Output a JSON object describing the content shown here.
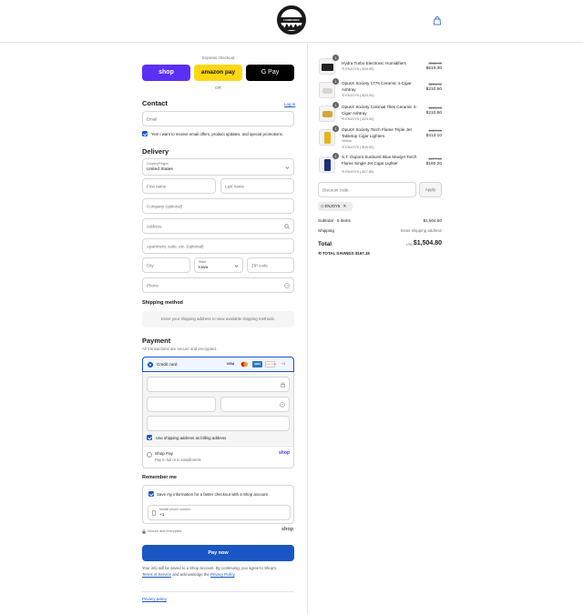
{
  "header": {
    "logo_text": "HUMIDORS",
    "cart_icon": "shopping-bag-icon"
  },
  "express": {
    "label": "Express checkout",
    "shop": "shop",
    "amazon": "amazon pay",
    "gpay": "G Pay",
    "or": "OR"
  },
  "contact": {
    "title": "Contact",
    "login": "Log in",
    "email_placeholder": "Email",
    "newsletter": "Yes! I want to receive email offers, product updates, and special promotions."
  },
  "delivery": {
    "title": "Delivery",
    "country_label": "Country/Region",
    "country_value": "United States",
    "first_name": "First name",
    "last_name": "Last name",
    "company": "Company (optional)",
    "address": "Address",
    "apartment": "Apartment, suite, etc. (optional)",
    "city": "City",
    "state_label": "State",
    "state_value": "Iowa",
    "zip": "ZIP code",
    "phone": "Phone"
  },
  "shipping_method": {
    "title": "Shipping method",
    "message": "Enter your shipping address to view available shipping methods."
  },
  "payment": {
    "title": "Payment",
    "subtitle": "All transactions are secure and encrypted.",
    "credit_card": "Credit card",
    "cards": [
      "VISA",
      "MC",
      "AMEX",
      "DISCOVER",
      "+4"
    ],
    "billing_same": "Use shipping address as billing address",
    "shop_pay": "Shop Pay",
    "shop_pay_sub": "Pay in full or in installments",
    "shop_pay_logo": "shop"
  },
  "remember": {
    "title": "Remember me",
    "save_info": "Save my information for a faster checkout with a Shop account",
    "mobile_label": "Mobile phone number",
    "mobile_value": "+1",
    "secure": "Secure and encrypted",
    "shop_logo": "shop"
  },
  "pay_now": "Pay now",
  "legal": {
    "text_1": "Your info will be saved to a Shop account. By continuing, you agree to Shop's",
    "terms": "Terms of Service",
    "text_2": "and acknowledge the",
    "privacy": "Privacy Policy",
    "end": "."
  },
  "privacy_policy": "Privacy policy",
  "order": {
    "items": [
      {
        "qty": "1",
        "name": "Hydra Turbo Electronic Humidifiers",
        "variant": "",
        "discount": "ENJOY5 (-$26.95)",
        "original": "$566.95",
        "price": "$510.30"
      },
      {
        "qty": "1",
        "name": "OpusX Society 1776 Ceramic 4-Cigar Ashtray",
        "variant": "",
        "discount": "ENJOY5 (-$23.00)",
        "original": "$234.00",
        "price": "$210.60"
      },
      {
        "qty": "1",
        "name": "OpusX Society Colonial Tiles Ceramic 4-Cigar Ashtray",
        "variant": "",
        "discount": "ENJOY5 (-$23.00)",
        "original": "$234.00",
        "price": "$210.60"
      },
      {
        "qty": "1",
        "name": "OpusX Society Torch Flame Triple Jet Tabletop Cigar Lighters",
        "variant": "Yellow",
        "discount": "ENJOY5 (-$45.90)",
        "original": "$459.00",
        "price": "$413.10"
      },
      {
        "qty": "1",
        "name": "S.T. Dupont Sunburst Blue Maxijet Torch Flame Single Jet Cigar Lighter",
        "variant": "",
        "discount": "ENJOY5 (-$17.80)",
        "original": "$177.99",
        "price": "$160.20"
      }
    ],
    "discount_placeholder": "Discount code",
    "apply": "Apply",
    "applied_code": "ENJOY5",
    "subtotal_label": "Subtotal · 5 items",
    "subtotal_value": "$1,504.80",
    "shipping_label": "Shipping",
    "shipping_value": "Enter shipping address",
    "total_label": "Total",
    "currency": "USD",
    "total_value": "$1,504.80",
    "savings_label": "TOTAL SAVINGS",
    "savings_value": "$167.15"
  }
}
